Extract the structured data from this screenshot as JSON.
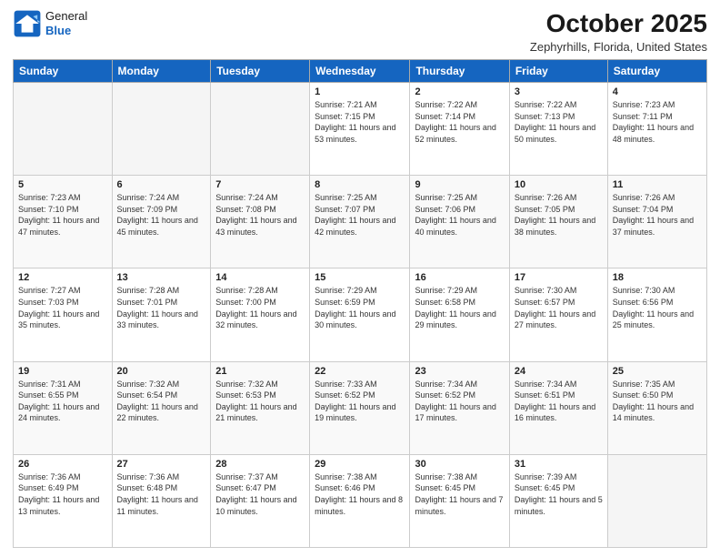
{
  "header": {
    "logo_general": "General",
    "logo_blue": "Blue",
    "month_title": "October 2025",
    "location": "Zephyrhills, Florida, United States"
  },
  "days_of_week": [
    "Sunday",
    "Monday",
    "Tuesday",
    "Wednesday",
    "Thursday",
    "Friday",
    "Saturday"
  ],
  "weeks": [
    [
      {
        "day": "",
        "empty": true
      },
      {
        "day": "",
        "empty": true
      },
      {
        "day": "",
        "empty": true
      },
      {
        "day": "1",
        "sunrise": "Sunrise: 7:21 AM",
        "sunset": "Sunset: 7:15 PM",
        "daylight": "Daylight: 11 hours and 53 minutes."
      },
      {
        "day": "2",
        "sunrise": "Sunrise: 7:22 AM",
        "sunset": "Sunset: 7:14 PM",
        "daylight": "Daylight: 11 hours and 52 minutes."
      },
      {
        "day": "3",
        "sunrise": "Sunrise: 7:22 AM",
        "sunset": "Sunset: 7:13 PM",
        "daylight": "Daylight: 11 hours and 50 minutes."
      },
      {
        "day": "4",
        "sunrise": "Sunrise: 7:23 AM",
        "sunset": "Sunset: 7:11 PM",
        "daylight": "Daylight: 11 hours and 48 minutes."
      }
    ],
    [
      {
        "day": "5",
        "sunrise": "Sunrise: 7:23 AM",
        "sunset": "Sunset: 7:10 PM",
        "daylight": "Daylight: 11 hours and 47 minutes."
      },
      {
        "day": "6",
        "sunrise": "Sunrise: 7:24 AM",
        "sunset": "Sunset: 7:09 PM",
        "daylight": "Daylight: 11 hours and 45 minutes."
      },
      {
        "day": "7",
        "sunrise": "Sunrise: 7:24 AM",
        "sunset": "Sunset: 7:08 PM",
        "daylight": "Daylight: 11 hours and 43 minutes."
      },
      {
        "day": "8",
        "sunrise": "Sunrise: 7:25 AM",
        "sunset": "Sunset: 7:07 PM",
        "daylight": "Daylight: 11 hours and 42 minutes."
      },
      {
        "day": "9",
        "sunrise": "Sunrise: 7:25 AM",
        "sunset": "Sunset: 7:06 PM",
        "daylight": "Daylight: 11 hours and 40 minutes."
      },
      {
        "day": "10",
        "sunrise": "Sunrise: 7:26 AM",
        "sunset": "Sunset: 7:05 PM",
        "daylight": "Daylight: 11 hours and 38 minutes."
      },
      {
        "day": "11",
        "sunrise": "Sunrise: 7:26 AM",
        "sunset": "Sunset: 7:04 PM",
        "daylight": "Daylight: 11 hours and 37 minutes."
      }
    ],
    [
      {
        "day": "12",
        "sunrise": "Sunrise: 7:27 AM",
        "sunset": "Sunset: 7:03 PM",
        "daylight": "Daylight: 11 hours and 35 minutes."
      },
      {
        "day": "13",
        "sunrise": "Sunrise: 7:28 AM",
        "sunset": "Sunset: 7:01 PM",
        "daylight": "Daylight: 11 hours and 33 minutes."
      },
      {
        "day": "14",
        "sunrise": "Sunrise: 7:28 AM",
        "sunset": "Sunset: 7:00 PM",
        "daylight": "Daylight: 11 hours and 32 minutes."
      },
      {
        "day": "15",
        "sunrise": "Sunrise: 7:29 AM",
        "sunset": "Sunset: 6:59 PM",
        "daylight": "Daylight: 11 hours and 30 minutes."
      },
      {
        "day": "16",
        "sunrise": "Sunrise: 7:29 AM",
        "sunset": "Sunset: 6:58 PM",
        "daylight": "Daylight: 11 hours and 29 minutes."
      },
      {
        "day": "17",
        "sunrise": "Sunrise: 7:30 AM",
        "sunset": "Sunset: 6:57 PM",
        "daylight": "Daylight: 11 hours and 27 minutes."
      },
      {
        "day": "18",
        "sunrise": "Sunrise: 7:30 AM",
        "sunset": "Sunset: 6:56 PM",
        "daylight": "Daylight: 11 hours and 25 minutes."
      }
    ],
    [
      {
        "day": "19",
        "sunrise": "Sunrise: 7:31 AM",
        "sunset": "Sunset: 6:55 PM",
        "daylight": "Daylight: 11 hours and 24 minutes."
      },
      {
        "day": "20",
        "sunrise": "Sunrise: 7:32 AM",
        "sunset": "Sunset: 6:54 PM",
        "daylight": "Daylight: 11 hours and 22 minutes."
      },
      {
        "day": "21",
        "sunrise": "Sunrise: 7:32 AM",
        "sunset": "Sunset: 6:53 PM",
        "daylight": "Daylight: 11 hours and 21 minutes."
      },
      {
        "day": "22",
        "sunrise": "Sunrise: 7:33 AM",
        "sunset": "Sunset: 6:52 PM",
        "daylight": "Daylight: 11 hours and 19 minutes."
      },
      {
        "day": "23",
        "sunrise": "Sunrise: 7:34 AM",
        "sunset": "Sunset: 6:52 PM",
        "daylight": "Daylight: 11 hours and 17 minutes."
      },
      {
        "day": "24",
        "sunrise": "Sunrise: 7:34 AM",
        "sunset": "Sunset: 6:51 PM",
        "daylight": "Daylight: 11 hours and 16 minutes."
      },
      {
        "day": "25",
        "sunrise": "Sunrise: 7:35 AM",
        "sunset": "Sunset: 6:50 PM",
        "daylight": "Daylight: 11 hours and 14 minutes."
      }
    ],
    [
      {
        "day": "26",
        "sunrise": "Sunrise: 7:36 AM",
        "sunset": "Sunset: 6:49 PM",
        "daylight": "Daylight: 11 hours and 13 minutes."
      },
      {
        "day": "27",
        "sunrise": "Sunrise: 7:36 AM",
        "sunset": "Sunset: 6:48 PM",
        "daylight": "Daylight: 11 hours and 11 minutes."
      },
      {
        "day": "28",
        "sunrise": "Sunrise: 7:37 AM",
        "sunset": "Sunset: 6:47 PM",
        "daylight": "Daylight: 11 hours and 10 minutes."
      },
      {
        "day": "29",
        "sunrise": "Sunrise: 7:38 AM",
        "sunset": "Sunset: 6:46 PM",
        "daylight": "Daylight: 11 hours and 8 minutes."
      },
      {
        "day": "30",
        "sunrise": "Sunrise: 7:38 AM",
        "sunset": "Sunset: 6:45 PM",
        "daylight": "Daylight: 11 hours and 7 minutes."
      },
      {
        "day": "31",
        "sunrise": "Sunrise: 7:39 AM",
        "sunset": "Sunset: 6:45 PM",
        "daylight": "Daylight: 11 hours and 5 minutes."
      },
      {
        "day": "",
        "empty": true
      }
    ]
  ]
}
